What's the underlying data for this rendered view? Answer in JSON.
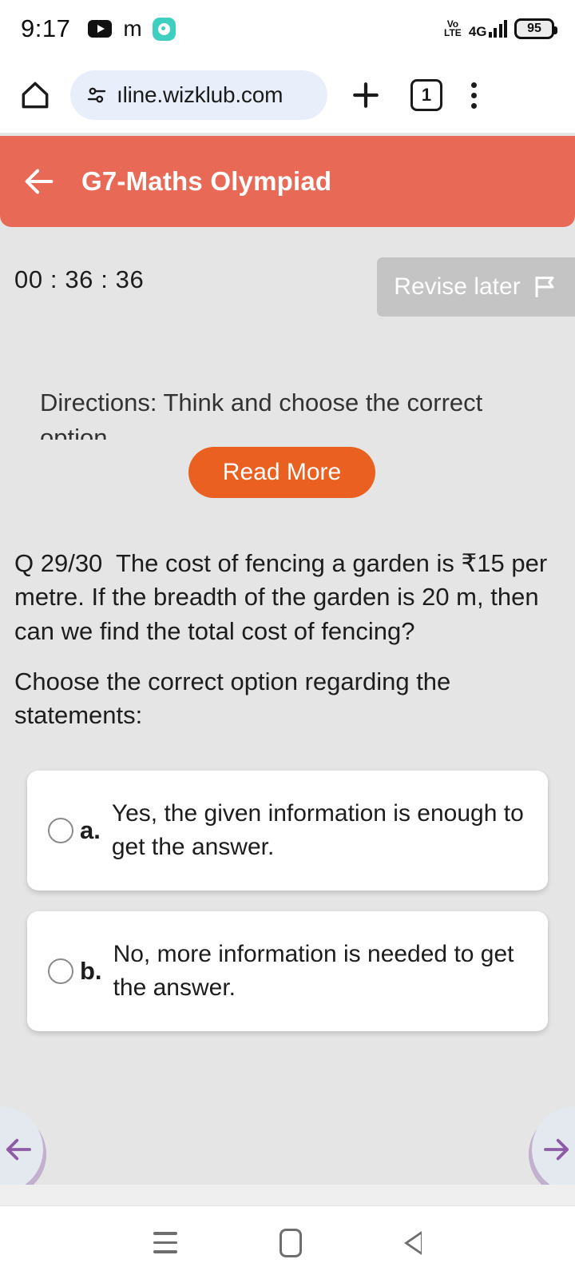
{
  "status_bar": {
    "time": "9:17",
    "icons": [
      "youtube-icon",
      "m-app-icon",
      "teal-app-icon"
    ],
    "network_label": "4G",
    "volte_line1": "Vo",
    "volte_line2": "LTE",
    "battery_level": "95"
  },
  "browser": {
    "home_icon": "home-icon",
    "url": "ıline.wizklub.com",
    "new_tab_icon": "plus-icon",
    "tab_count": "1",
    "menu_icon": "kebab-menu-icon"
  },
  "app_header": {
    "back_icon": "back-arrow-icon",
    "title": "G7-Maths Olympiad",
    "background_color": "#e86a56"
  },
  "quiz": {
    "timer": "00 : 36 : 36",
    "revise_later_label": "Revise later",
    "revise_later_icon": "flag-icon",
    "directions": "Directions: Think and choose the correct option.",
    "read_more_label": "Read More",
    "read_more_color": "#ea6021",
    "question_number": "Q 29/30",
    "question_text": "The cost of fencing a garden is ₹15 per metre. If the breadth of the garden is 20 m, then can we find the total cost of fencing?",
    "sub_prompt": "Choose the correct option regarding the statements:",
    "options": [
      {
        "letter": "a.",
        "text": "Yes, the given information is enough to get the answer.",
        "selected": false
      },
      {
        "letter": "b.",
        "text": "No, more information is needed to get the answer.",
        "selected": false
      }
    ],
    "prev_icon": "arrow-left-icon",
    "next_icon": "arrow-right-icon",
    "nav_arrow_color": "#8e5ba6"
  },
  "system_nav": {
    "recents_icon": "recents-icon",
    "home_icon": "home-square-icon",
    "back_icon": "back-triangle-icon"
  }
}
